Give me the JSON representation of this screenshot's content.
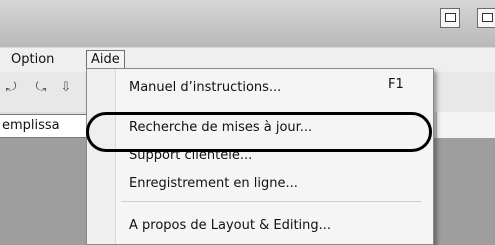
{
  "menubar": {
    "items": [
      {
        "label": "Option"
      },
      {
        "label": "Aide"
      }
    ]
  },
  "field": {
    "value": "emplissa"
  },
  "dropdown": {
    "items": [
      {
        "label": "Manuel d’instructions...",
        "shortcut": "F1"
      },
      {
        "label": "Recherche de mises à jour..."
      },
      {
        "label": "Support clientele..."
      },
      {
        "label": "Enregistrement en ligne..."
      },
      {
        "label": "A propos de Layout & Editing..."
      }
    ]
  }
}
